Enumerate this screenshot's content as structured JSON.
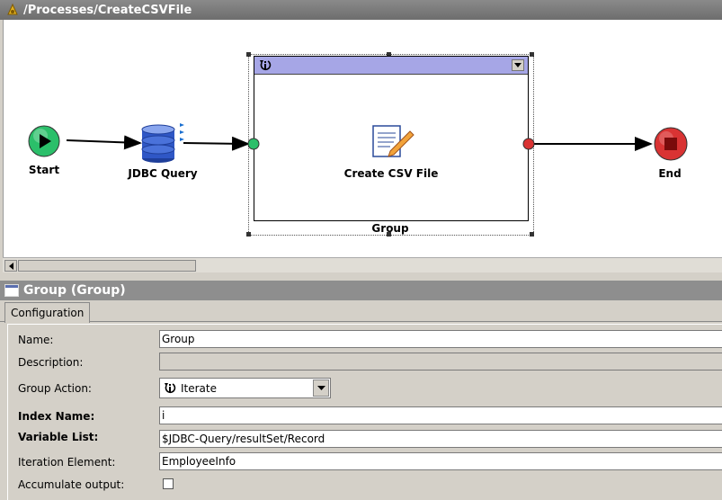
{
  "window": {
    "title": "/Processes/CreateCSVFile"
  },
  "diagram": {
    "nodes": {
      "start": "Start",
      "jdbc": "JDBC Query",
      "csv": "Create CSV File",
      "end": "End",
      "group": "Group"
    }
  },
  "panel": {
    "title": "Group (Group)",
    "tabs": [
      "Configuration"
    ]
  },
  "form": {
    "name_label": "Name:",
    "name_value": "Group",
    "description_label": "Description:",
    "description_value": "",
    "group_action_label": "Group Action:",
    "group_action_value": "Iterate",
    "index_name_label": "Index Name:",
    "index_name_value": "i",
    "variable_list_label": "Variable List:",
    "variable_list_value": "$JDBC-Query/resultSet/Record",
    "iteration_element_label": "Iteration Element:",
    "iteration_element_value": "EmployeeInfo",
    "accumulate_label": "Accumulate output:",
    "accumulate_checked": false
  },
  "colors": {
    "start": "#2bbf6a",
    "end": "#d93333",
    "group_header": "#a6a6e6",
    "titlebar": "#6d6d6d"
  }
}
